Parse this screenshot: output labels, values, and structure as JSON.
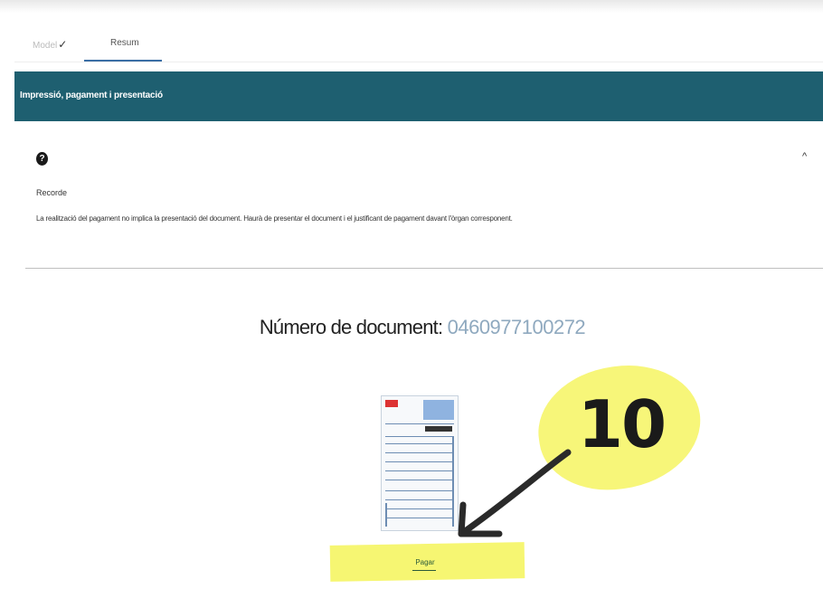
{
  "tabs": [
    {
      "label": "Model",
      "check": "✓"
    },
    {
      "label": "Resum"
    }
  ],
  "section": {
    "title": "Impressió, pagament i presentació"
  },
  "info": {
    "help_glyph": "?",
    "collapse_glyph": "^",
    "title": "Recorde",
    "text": "La realització del pagament no implica la presentació del document. Haurà de presentar el document i el justificant de pagament davant l'òrgan corresponent."
  },
  "document": {
    "label": "Número de document:",
    "number": "0460977100272"
  },
  "annotation": {
    "number": "10"
  },
  "actions": {
    "pay_label": "Pagar"
  },
  "colors": {
    "header_bar": "#1e5f70",
    "highlight": "#f6f56a",
    "tab_underline": "#3a6ea5"
  }
}
